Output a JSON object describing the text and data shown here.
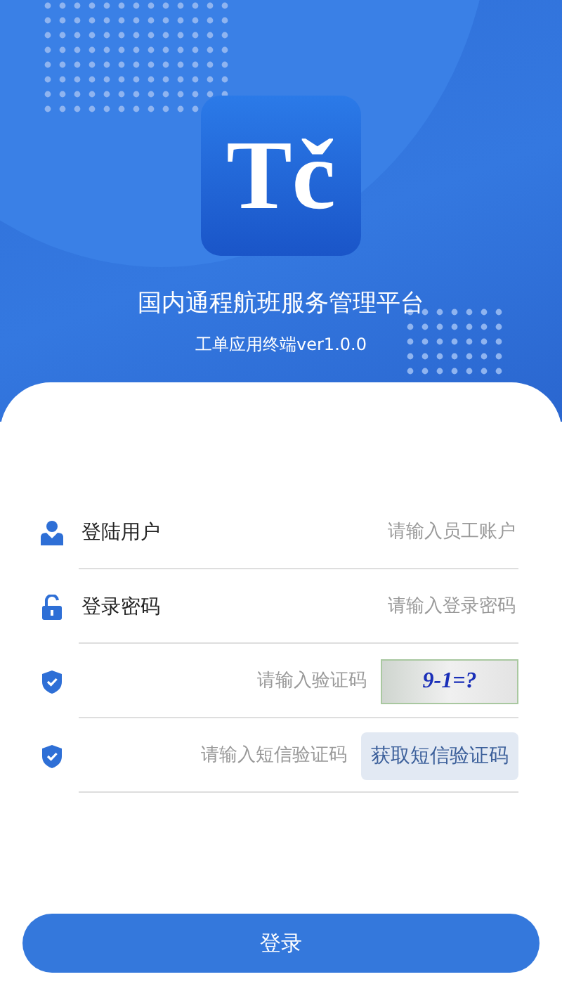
{
  "logo": {
    "text": "Tč"
  },
  "title": "国内通程航班服务管理平台",
  "subtitle": "工单应用终端ver1.0.0",
  "fields": [
    {
      "kind": "user",
      "label": "登陆用户",
      "placeholder": "请输入员工账户"
    },
    {
      "kind": "password",
      "label": "登录密码",
      "placeholder": "请输入登录密码"
    },
    {
      "kind": "captcha",
      "placeholder": "请输入验证码",
      "captcha": "9-1=?"
    },
    {
      "kind": "sms",
      "placeholder": "请输入短信验证码",
      "action": "获取短信验证码"
    }
  ],
  "login_button": "登录"
}
